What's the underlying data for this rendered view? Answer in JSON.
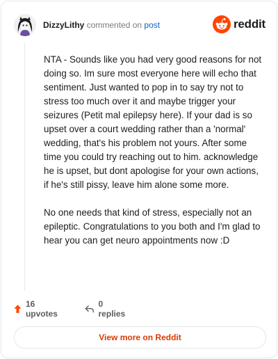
{
  "comment": {
    "username": "DizzyLithy",
    "action_text": "commented on",
    "post_link": "post",
    "paragraphs": [
      "NTA - Sounds like you had very good reasons for not doing so. Im sure most everyone here will echo that sentiment. Just wanted to pop in to say try not to stress too much over it and maybe trigger your seizures (Petit mal epilepsy here). If your dad is so upset over a court wedding rather than a 'normal' wedding, that's his problem not yours. After some time you could try reaching out to him. acknowledge he is upset, but dont apologise for your own actions, if he's still pissy, leave him alone some more.",
      "No one needs that kind of stress, especially not an epileptic. Congratulations to you both and I'm glad to hear you can get neuro appointments now :D"
    ]
  },
  "brand": {
    "name": "reddit",
    "color": "#ff4500"
  },
  "actions": {
    "upvotes_label": "16 upvotes",
    "replies_label": "0 replies"
  },
  "view_more_label": "View more on Reddit",
  "colors": {
    "link": "#0a66c2",
    "upvote": "#ff4500",
    "view_more_text": "#d93a00"
  }
}
